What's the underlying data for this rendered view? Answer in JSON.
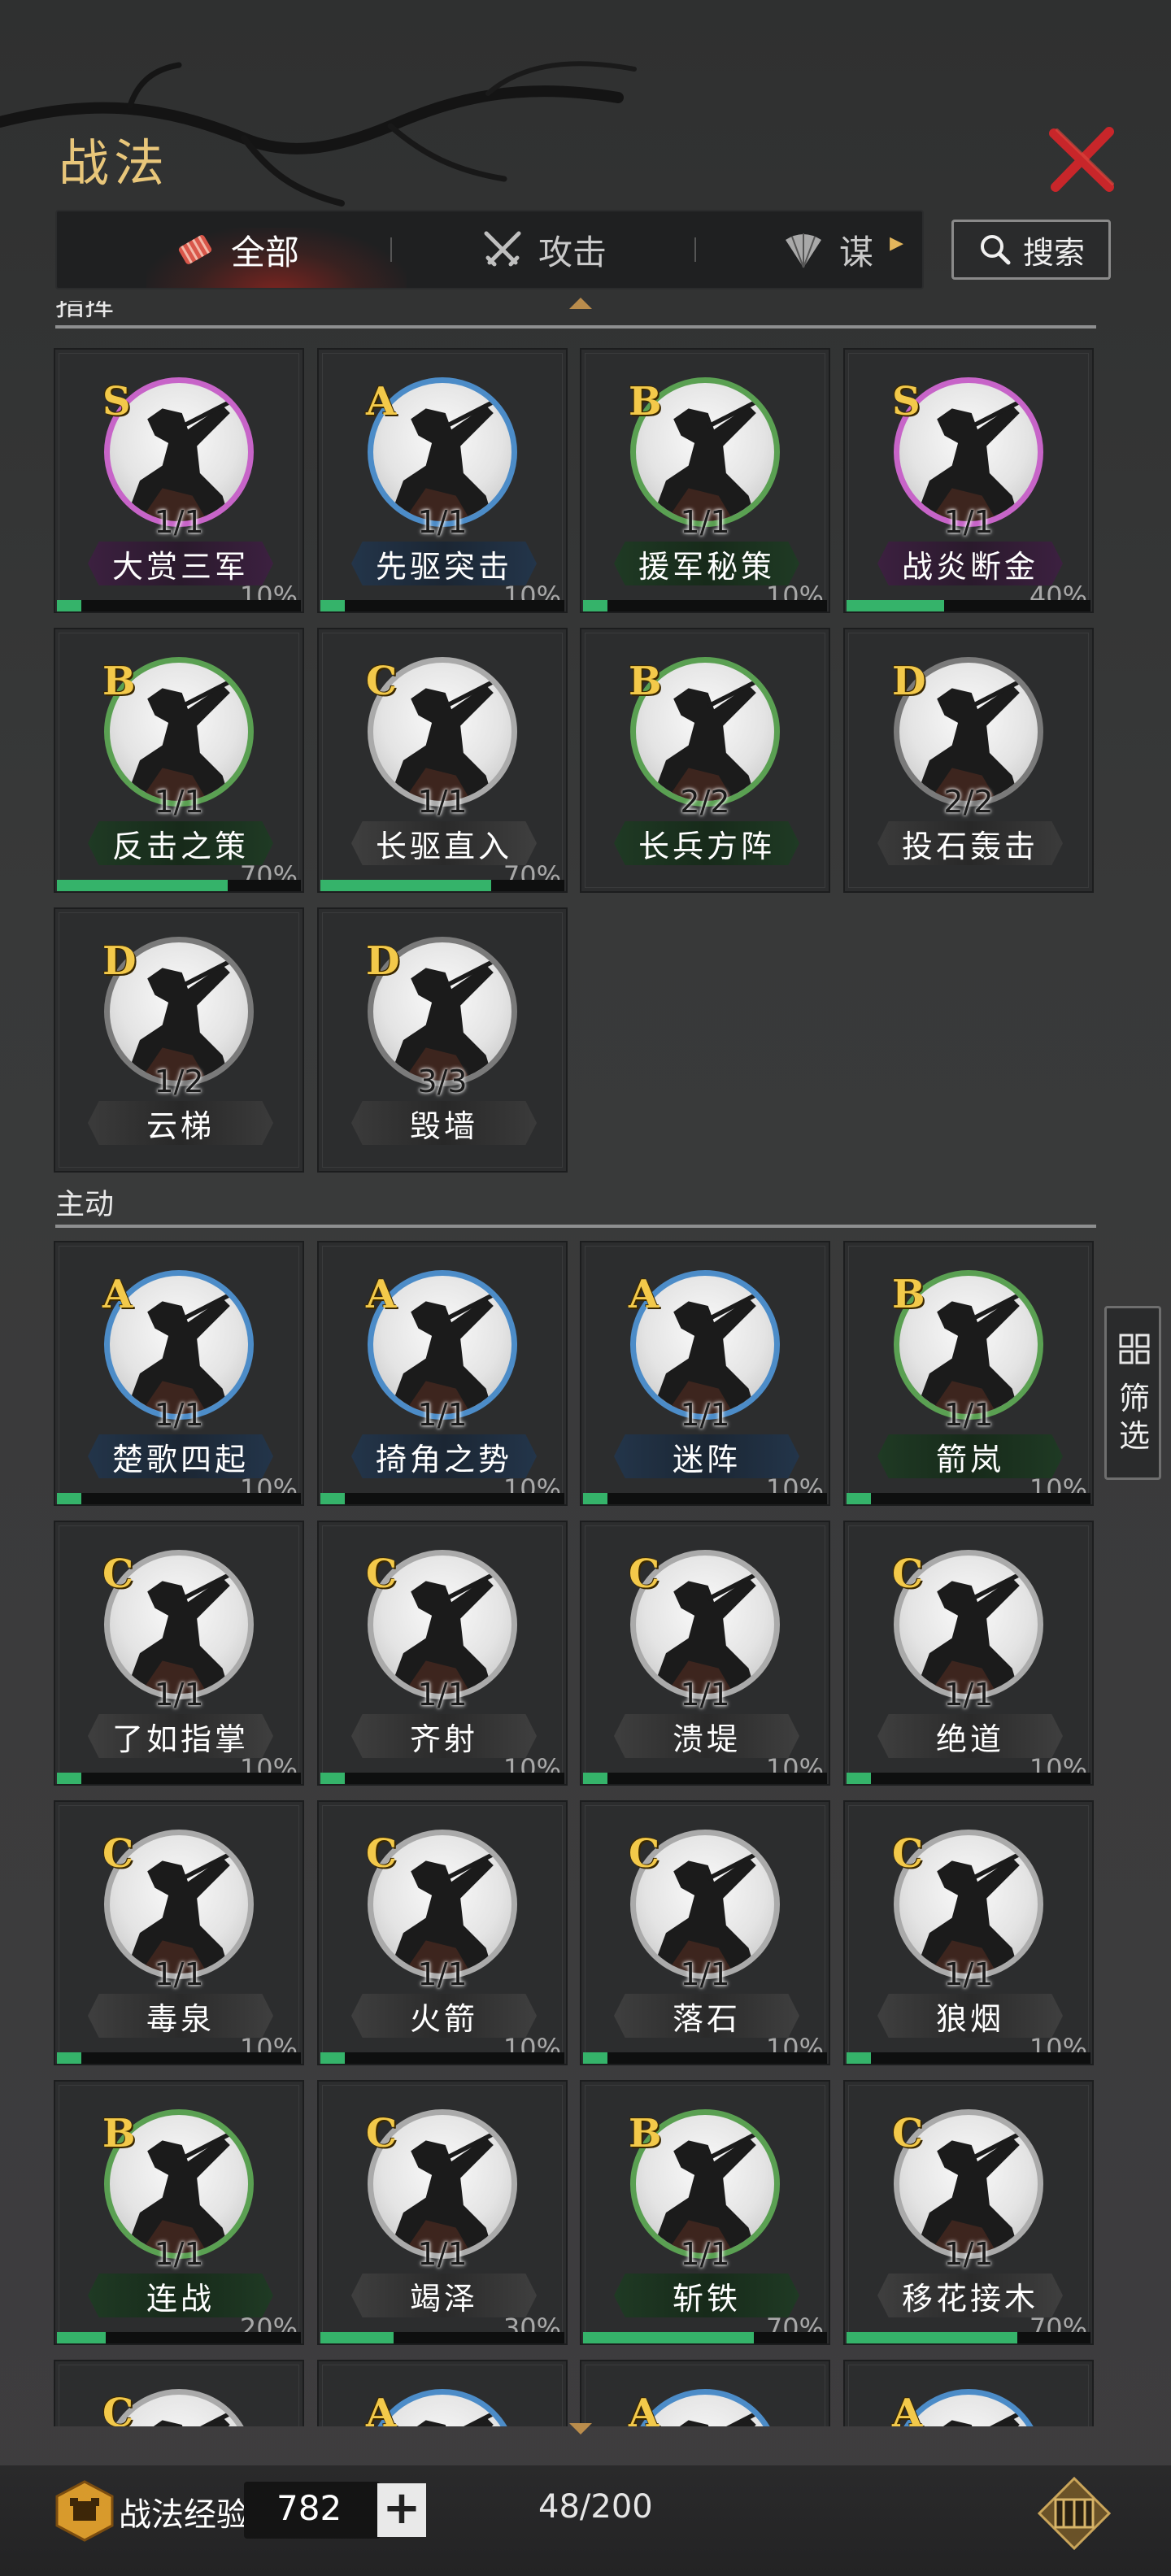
{
  "header": {
    "title": "战法"
  },
  "tabs": [
    {
      "label": "全部",
      "icon": "bundle-icon",
      "active": true
    },
    {
      "label": "攻击",
      "icon": "crossed-swords-icon",
      "active": false
    },
    {
      "label": "谋",
      "icon": "fan-icon",
      "active": false
    }
  ],
  "search": {
    "label": "搜索",
    "icon": "search-icon"
  },
  "filter": {
    "label": "筛选",
    "icon": "grid-icon"
  },
  "sections": [
    {
      "title": "指挥",
      "cards": [
        {
          "grade": "S",
          "count": "1/1",
          "name": "大赏三军",
          "progress": "10%"
        },
        {
          "grade": "A",
          "count": "1/1",
          "name": "先驱突击",
          "progress": "10%"
        },
        {
          "grade": "B",
          "count": "1/1",
          "name": "援军秘策",
          "progress": "10%"
        },
        {
          "grade": "S",
          "count": "1/1",
          "name": "战炎断金",
          "progress": "40%"
        },
        {
          "grade": "B",
          "count": "1/1",
          "name": "反击之策",
          "progress": "70%"
        },
        {
          "grade": "C",
          "count": "1/1",
          "name": "长驱直入",
          "progress": "70%"
        },
        {
          "grade": "B",
          "count": "2/2",
          "name": "长兵方阵",
          "progress": ""
        },
        {
          "grade": "D",
          "count": "2/2",
          "name": "投石轰击",
          "progress": ""
        },
        {
          "grade": "D",
          "count": "1/2",
          "name": "云梯",
          "progress": ""
        },
        {
          "grade": "D",
          "count": "3/3",
          "name": "毁墙",
          "progress": ""
        }
      ]
    },
    {
      "title": "主动",
      "cards": [
        {
          "grade": "A",
          "count": "1/1",
          "name": "楚歌四起",
          "progress": "10%"
        },
        {
          "grade": "A",
          "count": "1/1",
          "name": "掎角之势",
          "progress": "10%"
        },
        {
          "grade": "A",
          "count": "1/1",
          "name": "迷阵",
          "progress": "10%"
        },
        {
          "grade": "B",
          "count": "1/1",
          "name": "箭岚",
          "progress": "10%"
        },
        {
          "grade": "C",
          "count": "1/1",
          "name": "了如指掌",
          "progress": "10%"
        },
        {
          "grade": "C",
          "count": "1/1",
          "name": "齐射",
          "progress": "10%"
        },
        {
          "grade": "C",
          "count": "1/1",
          "name": "溃堤",
          "progress": "10%"
        },
        {
          "grade": "C",
          "count": "1/1",
          "name": "绝道",
          "progress": "10%"
        },
        {
          "grade": "C",
          "count": "1/1",
          "name": "毒泉",
          "progress": "10%"
        },
        {
          "grade": "C",
          "count": "1/1",
          "name": "火箭",
          "progress": "10%"
        },
        {
          "grade": "C",
          "count": "1/1",
          "name": "落石",
          "progress": "10%"
        },
        {
          "grade": "C",
          "count": "1/1",
          "name": "狼烟",
          "progress": "10%"
        },
        {
          "grade": "B",
          "count": "1/1",
          "name": "连战",
          "progress": "20%"
        },
        {
          "grade": "C",
          "count": "1/1",
          "name": "竭泽",
          "progress": "30%"
        },
        {
          "grade": "B",
          "count": "1/1",
          "name": "斩铁",
          "progress": "70%"
        },
        {
          "grade": "C",
          "count": "1/1",
          "name": "移花接木",
          "progress": "70%"
        },
        {
          "grade": "C",
          "count": "",
          "name": "",
          "progress": ""
        },
        {
          "grade": "A",
          "count": "",
          "name": "",
          "progress": ""
        },
        {
          "grade": "A",
          "count": "",
          "name": "",
          "progress": ""
        },
        {
          "grade": "A",
          "count": "",
          "name": "",
          "progress": ""
        }
      ]
    }
  ],
  "footer": {
    "exp_label": "战法经验",
    "exp_value": "782",
    "plus_label": "+",
    "capacity": "48/200"
  },
  "colors": {
    "accent_gold": "#e8c67a",
    "close_red": "#c8262a",
    "progress_green": "#35b36a",
    "grade_S": "#c764c8",
    "grade_A": "#4c8cc8",
    "grade_B": "#5aa052",
    "grade_C": "#aaaaaa",
    "grade_D": "#7a7a7a"
  }
}
